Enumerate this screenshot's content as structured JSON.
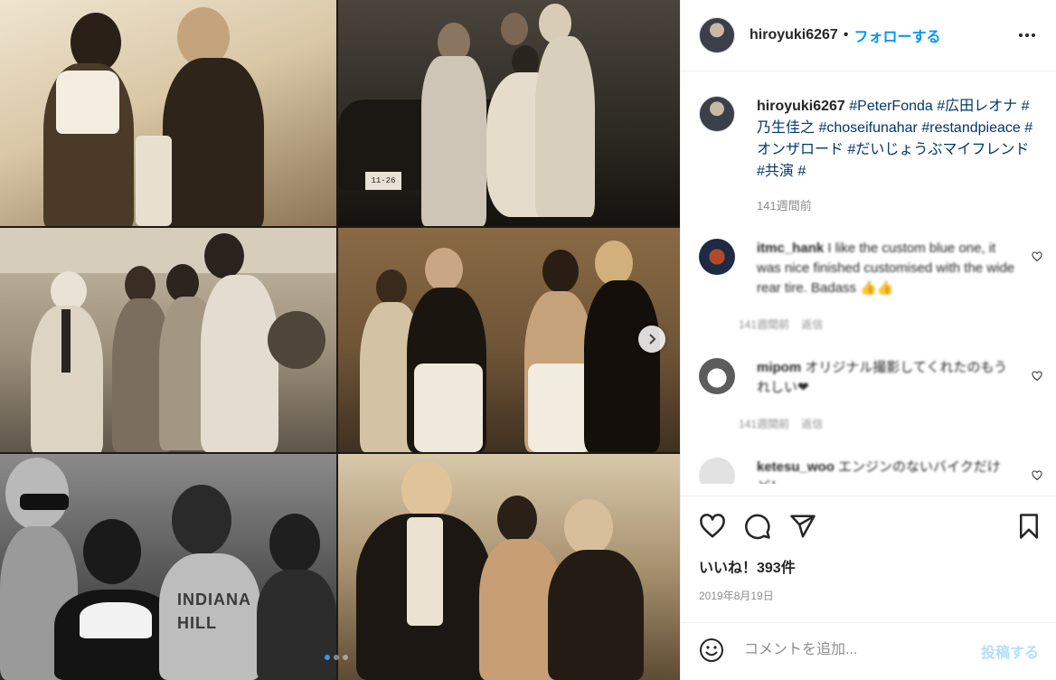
{
  "post": {
    "username": "hiroyuki6267",
    "separator": "•",
    "follow_label": "フォローする",
    "caption": {
      "username": "hiroyuki6267",
      "tags": [
        "#PeterFonda",
        "#広田レオナ",
        "#乃生佳之",
        "#choseifunahar",
        "#restandpieace",
        "#オンザロード",
        "#だいじょうぶマイフレンド",
        "#共演",
        "#"
      ],
      "time": "141週間前"
    },
    "comments": [
      {
        "username": "itmc_hank",
        "text": "I like the custom blue one, it was nice finished customised with the wide rear tire. Badass 👍👍",
        "time": "141週間前",
        "reply": "返信"
      },
      {
        "username": "mipom",
        "text": "オリジナル撮影してくれたのもうれしい❤",
        "time": "141週間前",
        "reply": "返信"
      },
      {
        "username": "ketesu_woo",
        "text": "エンジンのないバイクだけど！",
        "time": "",
        "reply": ""
      }
    ],
    "likes": "いいね！393件",
    "date": "2019年8月19日",
    "comment_placeholder": "コメントを追加...",
    "post_button": "投稿する"
  },
  "media": {
    "plate_text": "11-26",
    "shirt_text": "INDIANA HILL",
    "carousel": {
      "total": 3,
      "current": 1
    }
  },
  "colors": {
    "link_blue": "#0095f6",
    "tag_blue": "#00376b",
    "muted": "#8e8e8e",
    "post_disabled": "#b2dffc"
  },
  "icons": [
    "more-icon",
    "heart-icon",
    "comment-icon",
    "share-icon",
    "bookmark-icon",
    "smile-icon",
    "chevron-right-icon"
  ]
}
